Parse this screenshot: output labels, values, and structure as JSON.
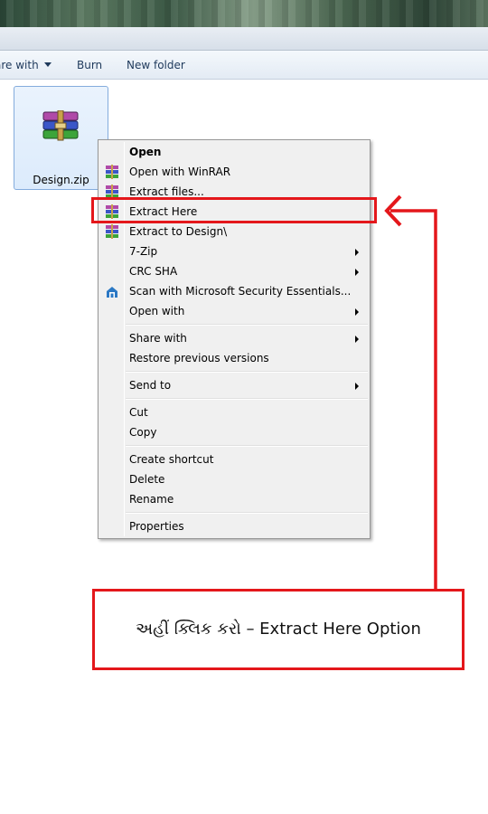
{
  "toolbar": {
    "share_label": "are with",
    "burn_label": "Burn",
    "new_folder_label": "New folder"
  },
  "file": {
    "name": "Design.zip",
    "icon": "winrar-archive-icon"
  },
  "context_menu": {
    "items": [
      {
        "label": "Open",
        "bold": true
      },
      {
        "label": "Open with WinRAR",
        "icon": "winrar-icon"
      },
      {
        "label": "Extract files...",
        "icon": "winrar-icon"
      },
      {
        "label": "Extract Here",
        "icon": "winrar-icon"
      },
      {
        "label": "Extract to Design\\",
        "icon": "winrar-icon"
      },
      {
        "label": "7-Zip",
        "submenu": true
      },
      {
        "label": "CRC SHA",
        "submenu": true
      },
      {
        "label": "Scan with Microsoft Security Essentials...",
        "icon": "security-essentials-icon"
      },
      {
        "label": "Open with",
        "submenu": true
      },
      {
        "label": "Share with",
        "submenu": true
      },
      {
        "label": "Restore previous versions"
      },
      {
        "label": "Send to",
        "submenu": true
      },
      {
        "label": "Cut"
      },
      {
        "label": "Copy"
      },
      {
        "label": "Create shortcut"
      },
      {
        "label": "Delete"
      },
      {
        "label": "Rename"
      },
      {
        "label": "Properties"
      }
    ]
  },
  "annotation": {
    "callout_text": "અહીં ક્લિક કરો – Extract Here Option",
    "color": "#e4171b"
  }
}
